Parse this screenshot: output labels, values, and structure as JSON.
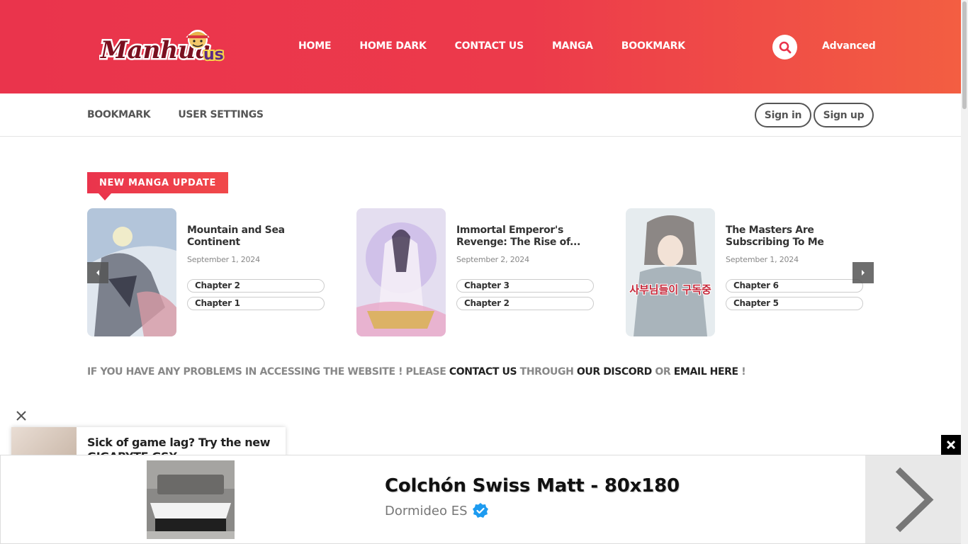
{
  "header": {
    "logo_text": "Manhua",
    "logo_suffix": "us",
    "nav": [
      "HOME",
      "HOME DARK",
      "CONTACT US",
      "MANGA",
      "BOOKMARK"
    ],
    "advanced_label": "Advanced"
  },
  "subnav": {
    "links": [
      "BOOKMARK",
      "USER SETTINGS"
    ],
    "signin_label": "Sign in",
    "signup_label": "Sign up"
  },
  "section": {
    "badge": "NEW MANGA UPDATE"
  },
  "cards": [
    {
      "title": "Mountain and Sea Continent",
      "date": "September 1, 2024",
      "chapters": [
        "Chapter 2",
        "Chapter 1"
      ]
    },
    {
      "title": "Immortal Emperor's Revenge: The Rise of...",
      "date": "September 2, 2024",
      "chapters": [
        "Chapter 3",
        "Chapter 2"
      ]
    },
    {
      "title": "The Masters Are Subscribing To Me",
      "date": "September 1, 2024",
      "chapters": [
        "Chapter 6",
        "Chapter 5"
      ],
      "cover_text": "사부님들이 구독중"
    }
  ],
  "notice": {
    "part1": "IF YOU HAVE ANY PROBLEMS IN ACCESSING THE WEBSITE ! PLEASE ",
    "link1": "CONTACT US",
    "part2": " THROUGH ",
    "link2": "OUR DISCORD",
    "part3": " OR ",
    "link3": "EMAIL HERE",
    "part4": " !"
  },
  "popup_ad": {
    "title": "Sick of game lag? Try the new GIGABYTE GSX"
  },
  "bottom_ad": {
    "title": "Colchón Swiss Matt - 80x180",
    "brand": "Dormideo ES"
  },
  "colors": {
    "header_start": "#ea344c",
    "header_end": "#f35e42",
    "accent": "#ea344c"
  }
}
